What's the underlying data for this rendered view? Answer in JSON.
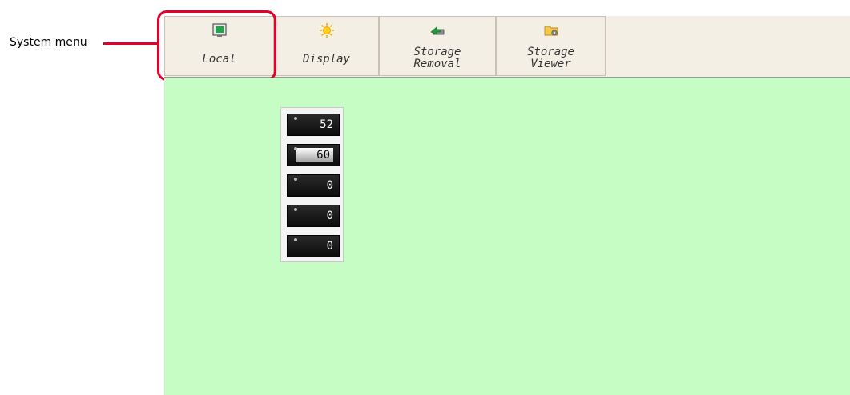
{
  "callout": {
    "label": "System menu"
  },
  "system_menu": {
    "buttons": [
      {
        "label": "Local",
        "icon": "monitor-icon"
      },
      {
        "label": "Display",
        "icon": "sun-icon"
      },
      {
        "label_line1": "Storage",
        "label_line2": "Removal",
        "icon": "storage-removal-icon"
      },
      {
        "label_line1": "Storage",
        "label_line2": "Viewer",
        "icon": "folder-gear-icon"
      }
    ]
  },
  "numeric_displays": [
    {
      "value": "52"
    },
    {
      "value": "60",
      "selected": true
    },
    {
      "value": "0"
    },
    {
      "value": "0"
    },
    {
      "value": "0"
    }
  ],
  "colors": {
    "highlight": "#e4002b",
    "screen_background": "#c5fdc5",
    "toolbar_background": "#f3efe4"
  }
}
